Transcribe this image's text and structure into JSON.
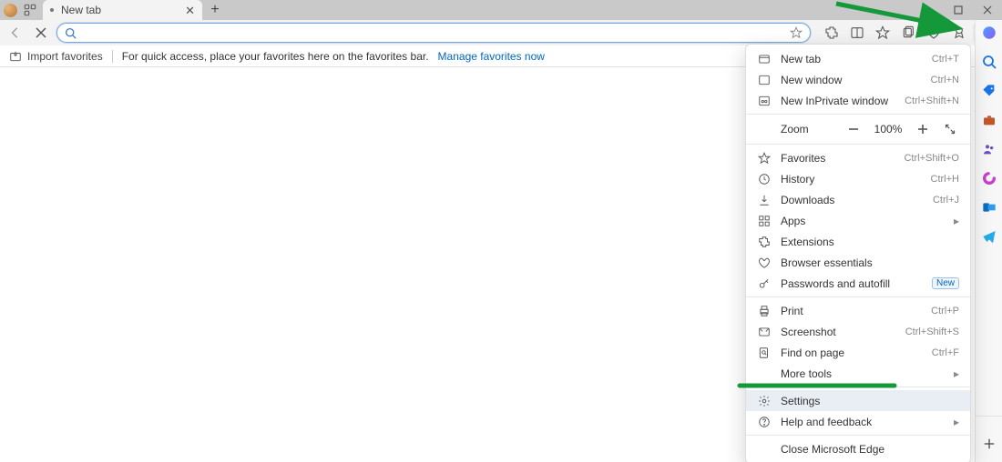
{
  "tabbar": {
    "tab_title": "New tab",
    "new_tab_tooltip": "+"
  },
  "window": {
    "minimize": "–",
    "maximize": "▢",
    "close": "✕"
  },
  "toolbar": {
    "address_value": "",
    "address_placeholder": ""
  },
  "infobar": {
    "import_label": "Import favorites",
    "hint_text": "For quick access, place your favorites here on the favorites bar.  ",
    "manage_link": "Manage favorites now"
  },
  "menu": {
    "new_tab": "New tab",
    "new_tab_shortcut": "Ctrl+T",
    "new_window": "New window",
    "new_window_shortcut": "Ctrl+N",
    "inprivate": "New InPrivate window",
    "inprivate_shortcut": "Ctrl+Shift+N",
    "zoom_label": "Zoom",
    "zoom_value": "100%",
    "favorites": "Favorites",
    "favorites_shortcut": "Ctrl+Shift+O",
    "history": "History",
    "history_shortcut": "Ctrl+H",
    "downloads": "Downloads",
    "downloads_shortcut": "Ctrl+J",
    "apps": "Apps",
    "extensions": "Extensions",
    "essentials": "Browser essentials",
    "passwords": "Passwords and autofill",
    "passwords_badge": "New",
    "print": "Print",
    "print_shortcut": "Ctrl+P",
    "screenshot": "Screenshot",
    "screenshot_shortcut": "Ctrl+Shift+S",
    "find": "Find on page",
    "find_shortcut": "Ctrl+F",
    "more_tools": "More tools",
    "settings": "Settings",
    "help": "Help and feedback",
    "close_edge": "Close Microsoft Edge"
  },
  "sidebar_icons": [
    "copilot-icon",
    "search-icon",
    "tag-icon",
    "briefcase-icon",
    "people-icon",
    "loop-icon",
    "outlook-icon",
    "send-icon"
  ]
}
